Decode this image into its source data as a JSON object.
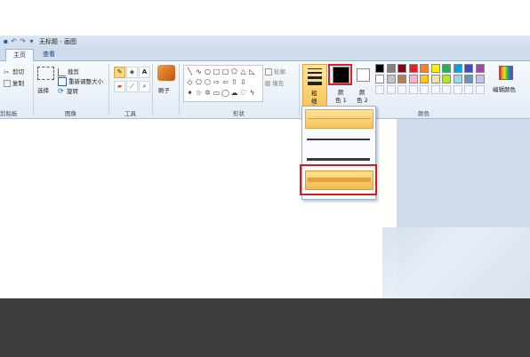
{
  "app": {
    "title": "无标题 - 画图",
    "quick_access": [
      "save-icon",
      "undo-icon",
      "redo-icon",
      "qat-menu-icon"
    ]
  },
  "tabs": [
    {
      "label": "主页",
      "active": true
    },
    {
      "label": "查看",
      "active": false
    }
  ],
  "ribbon": {
    "clipboard": {
      "cut": "剪切",
      "copy": "复制",
      "group": "剪贴板"
    },
    "image": {
      "select": "选择",
      "crop": "裁剪",
      "resize": "重新调整大小",
      "rotate": "旋转",
      "group": "图像"
    },
    "tools": {
      "group": "工具"
    },
    "brushes": {
      "label": "刷子"
    },
    "shapes": {
      "outline": "轮廓",
      "fill": "填充",
      "group": "形状"
    },
    "size": {
      "label1": "粗",
      "label2": "细"
    },
    "color1": {
      "label1": "颜",
      "label2": "色 1"
    },
    "color2": {
      "label1": "颜",
      "label2": "色 2"
    },
    "colors": {
      "group": "颜色",
      "edit": "编辑颜色"
    }
  },
  "palette": {
    "row1": [
      "#000000",
      "#7f7f7f",
      "#880015",
      "#ed1c24",
      "#ff7f27",
      "#fff200",
      "#22b14c",
      "#00a2e8",
      "#3f48cc",
      "#a349a4"
    ],
    "row2": [
      "#ffffff",
      "#c3c3c3",
      "#b97a57",
      "#ffaec9",
      "#ffc90e",
      "#efe4b0",
      "#b5e61d",
      "#99d9ea",
      "#7092be",
      "#c8bfe7"
    ]
  },
  "size_options": [
    {
      "weight": "thin",
      "selected": true
    },
    {
      "weight": "medium",
      "selected": false
    },
    {
      "weight": "thick",
      "selected": false
    },
    {
      "weight": "thickest",
      "selected": false,
      "highlighted": true
    }
  ],
  "colors": {
    "accent": "#2a5ca8",
    "highlight": "#e02020",
    "color1": "#000000",
    "color2": "#ffffff"
  }
}
